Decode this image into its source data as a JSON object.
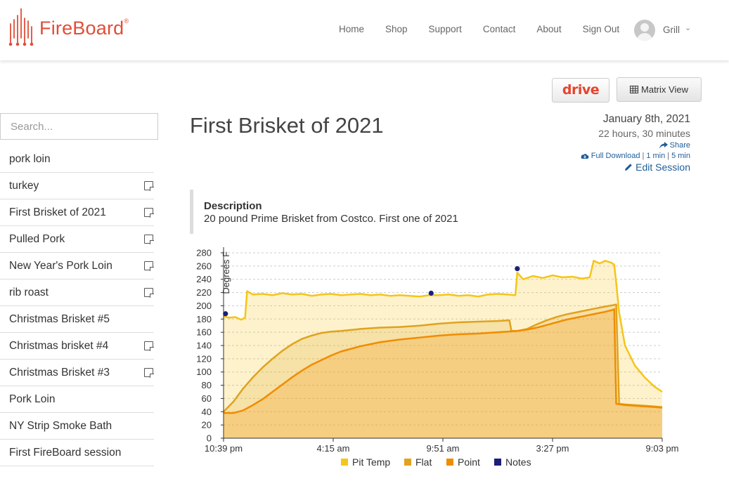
{
  "header": {
    "logo_text": "FireBoard",
    "logo_reg": "®",
    "nav": [
      "Home",
      "Shop",
      "Support",
      "Contact",
      "About",
      "Sign Out"
    ],
    "user_name": "Grill",
    "user_caret": "⌄"
  },
  "toolbar": {
    "drive_label": "drive",
    "matrix_label": "Matrix View"
  },
  "search": {
    "placeholder": "Search..."
  },
  "sidebar": {
    "items": [
      {
        "label": "pork loin",
        "has_note": false
      },
      {
        "label": "turkey",
        "has_note": true
      },
      {
        "label": "First Brisket of 2021",
        "has_note": true
      },
      {
        "label": "Pulled Pork",
        "has_note": true
      },
      {
        "label": "New Year's Pork Loin",
        "has_note": true
      },
      {
        "label": "rib roast",
        "has_note": true
      },
      {
        "label": "Christmas Brisket #5",
        "has_note": false
      },
      {
        "label": "Christmas brisket #4",
        "has_note": true
      },
      {
        "label": "Christmas Brisket #3",
        "has_note": true
      },
      {
        "label": "Pork Loin",
        "has_note": false
      },
      {
        "label": "NY Strip Smoke Bath",
        "has_note": false
      },
      {
        "label": "First FireBoard session",
        "has_note": false
      }
    ]
  },
  "session": {
    "title": "First Brisket of 2021",
    "date": "January 8th, 2021",
    "duration": "22 hours, 30 minutes",
    "share": "Share",
    "full_download": "Full Download",
    "one_min": "1 min",
    "five_min": "5 min",
    "edit": "Edit Session",
    "separator": "|"
  },
  "description": {
    "title": "Description",
    "text": "20 pound Prime Brisket from Costco. First one of 2021"
  },
  "chart_data": {
    "type": "area",
    "ylabel": "Degrees F",
    "ylim": [
      0,
      280
    ],
    "yticks": [
      "0",
      "20",
      "40",
      "60",
      "80",
      "100",
      "120",
      "140",
      "160",
      "180",
      "200",
      "220",
      "240",
      "260",
      "280"
    ],
    "xlim": [
      0,
      22.4
    ],
    "xticks": [
      {
        "t": 0,
        "label": "10:39 pm"
      },
      {
        "t": 5.6,
        "label": "4:15 am"
      },
      {
        "t": 11.2,
        "label": "9:51 am"
      },
      {
        "t": 16.8,
        "label": "3:27 pm"
      },
      {
        "t": 22.4,
        "label": "9:03 pm"
      }
    ],
    "grid": true,
    "legend_position": "bottom",
    "series": [
      {
        "name": "Pit Temp",
        "color": "#f5c518",
        "points": [
          [
            0,
            184
          ],
          [
            0.3,
            182
          ],
          [
            0.6,
            183
          ],
          [
            0.9,
            179
          ],
          [
            1.1,
            182
          ],
          [
            1.2,
            222
          ],
          [
            1.5,
            217
          ],
          [
            2,
            218
          ],
          [
            2.5,
            216
          ],
          [
            3,
            219
          ],
          [
            3.5,
            217
          ],
          [
            4,
            218
          ],
          [
            4.5,
            215
          ],
          [
            5,
            217
          ],
          [
            5.5,
            218
          ],
          [
            6,
            216
          ],
          [
            6.5,
            217
          ],
          [
            7,
            218
          ],
          [
            7.5,
            216
          ],
          [
            8,
            217
          ],
          [
            8.5,
            215
          ],
          [
            9,
            216
          ],
          [
            9.5,
            215
          ],
          [
            10,
            214
          ],
          [
            10.5,
            216
          ],
          [
            11,
            216
          ],
          [
            11.5,
            217
          ],
          [
            12,
            215
          ],
          [
            12.5,
            216
          ],
          [
            13,
            214
          ],
          [
            13.5,
            217
          ],
          [
            14,
            218
          ],
          [
            14.5,
            217
          ],
          [
            14.9,
            216
          ],
          [
            15,
            250
          ],
          [
            15.3,
            240
          ],
          [
            15.8,
            245
          ],
          [
            16.3,
            242
          ],
          [
            16.8,
            246
          ],
          [
            17.3,
            243
          ],
          [
            17.8,
            244
          ],
          [
            18.3,
            241
          ],
          [
            18.7,
            243
          ],
          [
            18.9,
            268
          ],
          [
            19.2,
            264
          ],
          [
            19.5,
            268
          ],
          [
            19.8,
            265
          ],
          [
            19.95,
            262
          ],
          [
            20.05,
            235
          ],
          [
            20.2,
            190
          ],
          [
            20.5,
            140
          ],
          [
            21,
            110
          ],
          [
            21.5,
            92
          ],
          [
            22,
            78
          ],
          [
            22.4,
            70
          ]
        ]
      },
      {
        "name": "Flat",
        "color": "#e0a21f",
        "points": [
          [
            0,
            40
          ],
          [
            0.5,
            55
          ],
          [
            1,
            75
          ],
          [
            1.5,
            92
          ],
          [
            2,
            107
          ],
          [
            2.5,
            120
          ],
          [
            3,
            132
          ],
          [
            3.5,
            142
          ],
          [
            4,
            150
          ],
          [
            4.5,
            155
          ],
          [
            5,
            159
          ],
          [
            5.5,
            161
          ],
          [
            6,
            162
          ],
          [
            7,
            165
          ],
          [
            8,
            167
          ],
          [
            9,
            168
          ],
          [
            10,
            170
          ],
          [
            11,
            173
          ],
          [
            12,
            175
          ],
          [
            13,
            176
          ],
          [
            14,
            177
          ],
          [
            14.6,
            178
          ],
          [
            14.7,
            162
          ],
          [
            15,
            162
          ],
          [
            15.5,
            165
          ],
          [
            16,
            172
          ],
          [
            16.5,
            178
          ],
          [
            17,
            183
          ],
          [
            17.5,
            187
          ],
          [
            18,
            190
          ],
          [
            18.5,
            193
          ],
          [
            19,
            196
          ],
          [
            19.5,
            199
          ],
          [
            19.9,
            201
          ],
          [
            20.05,
            202
          ],
          [
            20.2,
            52
          ],
          [
            20.5,
            51
          ],
          [
            21,
            50
          ],
          [
            21.5,
            49
          ],
          [
            22,
            48
          ],
          [
            22.4,
            47
          ]
        ]
      },
      {
        "name": "Point",
        "color": "#f08c00",
        "points": [
          [
            0,
            38
          ],
          [
            0.5,
            38
          ],
          [
            1,
            42
          ],
          [
            1.5,
            50
          ],
          [
            2,
            59
          ],
          [
            2.5,
            70
          ],
          [
            3,
            81
          ],
          [
            3.5,
            92
          ],
          [
            4,
            102
          ],
          [
            4.5,
            111
          ],
          [
            5,
            118
          ],
          [
            5.5,
            125
          ],
          [
            6,
            131
          ],
          [
            7,
            139
          ],
          [
            8,
            145
          ],
          [
            9,
            149
          ],
          [
            10,
            152
          ],
          [
            11,
            155
          ],
          [
            12,
            157
          ],
          [
            13,
            158
          ],
          [
            14,
            160
          ],
          [
            14.5,
            161
          ],
          [
            15,
            162
          ],
          [
            15.5,
            164
          ],
          [
            16,
            167
          ],
          [
            16.5,
            171
          ],
          [
            17,
            175
          ],
          [
            17.5,
            179
          ],
          [
            18,
            182
          ],
          [
            18.5,
            185
          ],
          [
            19,
            188
          ],
          [
            19.5,
            191
          ],
          [
            19.9,
            194
          ],
          [
            19.95,
            195
          ],
          [
            20.05,
            52
          ],
          [
            20.5,
            50
          ],
          [
            21,
            49
          ],
          [
            21.5,
            48
          ],
          [
            22,
            47
          ],
          [
            22.4,
            46
          ]
        ]
      }
    ],
    "notes": {
      "name": "Notes",
      "color": "#1b1f7a",
      "points": [
        [
          0.1,
          188
        ],
        [
          10.6,
          219
        ],
        [
          15.0,
          256
        ]
      ]
    }
  }
}
